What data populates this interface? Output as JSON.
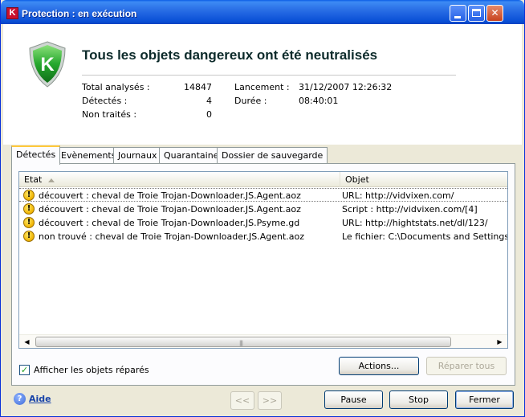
{
  "window": {
    "title": "Protection : en exécution",
    "app_icon": "K"
  },
  "header": {
    "headline": "Tous les objets dangereux ont été neutralisés",
    "shield_letter": "K"
  },
  "stats": {
    "total_label": "Total analysés :",
    "total_value": "14847",
    "detected_label": "Détectés  :",
    "detected_value": "4",
    "untreated_label": "Non traités  :",
    "untreated_value": "0",
    "launch_label": "Lancement :",
    "launch_value": "31/12/2007 12:26:32",
    "duration_label": "Durée :",
    "duration_value": "08:40:01"
  },
  "tabs": [
    {
      "label": "Détectés",
      "active": true
    },
    {
      "label": "Evènements",
      "active": false
    },
    {
      "label": "Journaux",
      "active": false
    },
    {
      "label": "Quarantaine",
      "active": false
    },
    {
      "label": "Dossier de sauvegarde",
      "active": false
    }
  ],
  "list": {
    "columns": [
      "Etat",
      "Objet"
    ],
    "rows": [
      {
        "etat": "découvert : cheval de Troie Trojan-Downloader.JS.Agent.aoz",
        "objet": "URL: http://vidvixen.com/"
      },
      {
        "etat": "découvert : cheval de Troie Trojan-Downloader.JS.Agent.aoz",
        "objet": "Script : http://vidvixen.com/[4]"
      },
      {
        "etat": "découvert : cheval de Troie Trojan-Downloader.JS.Psyme.gd",
        "objet": "URL: http://hightstats.net/dl/123/"
      },
      {
        "etat": "non trouvé : cheval de Troie Trojan-Downloader.JS.Agent.aoz",
        "objet": "Le fichier: C:\\Documents and Settings\\Pap"
      }
    ]
  },
  "checkbox": {
    "label": "Afficher les objets réparés",
    "checked": true
  },
  "buttons": {
    "actions": "Actions...",
    "repair_all": "Réparer tous",
    "prev": "<<",
    "next": ">>",
    "pause": "Pause",
    "stop": "Stop",
    "close": "Fermer"
  },
  "help": {
    "label": "Aide"
  }
}
